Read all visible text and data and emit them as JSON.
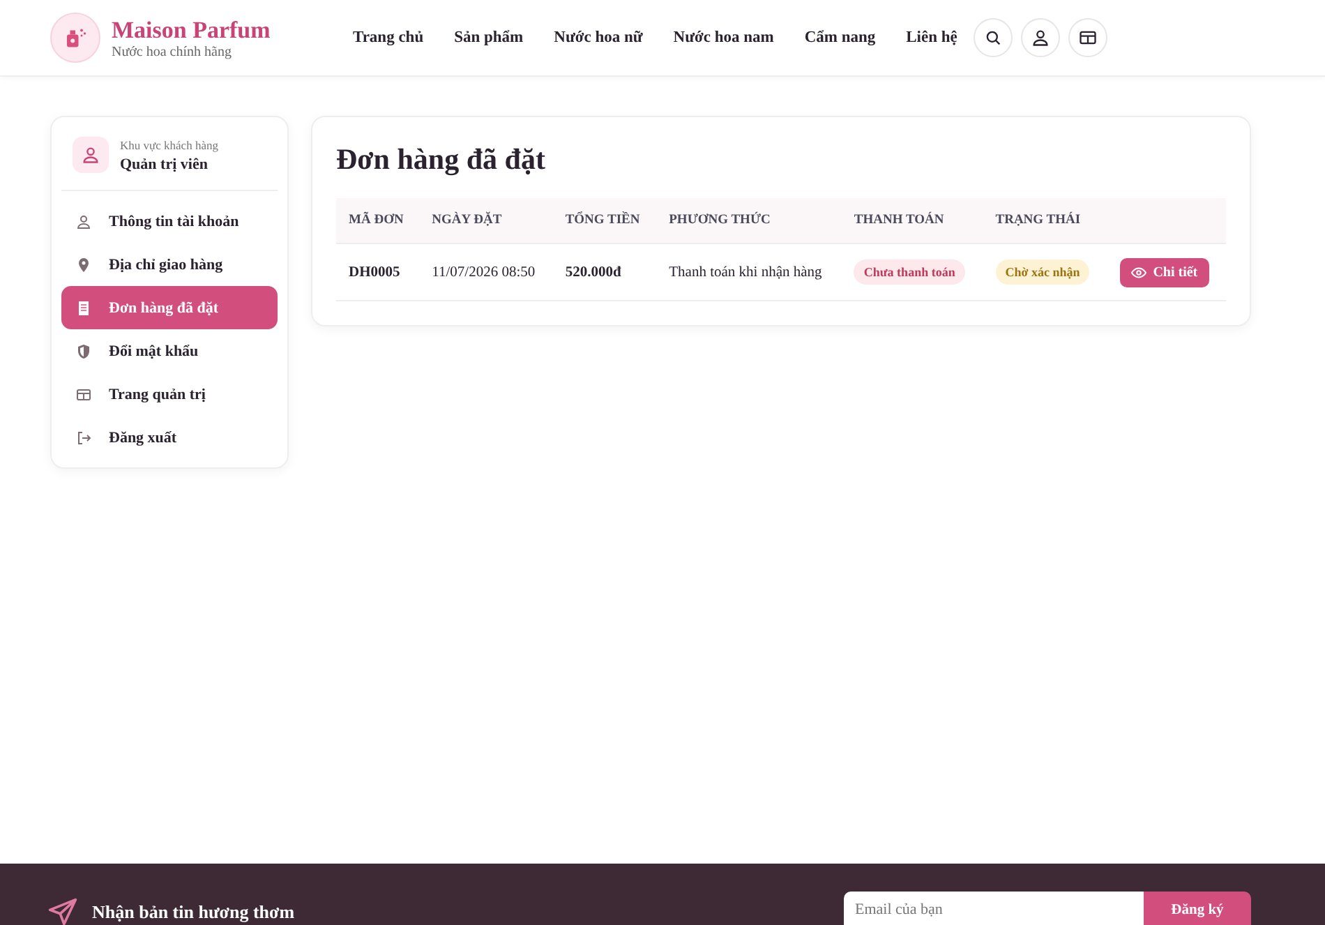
{
  "brand": {
    "name": "Maison Parfum",
    "tagline": "Nước hoa chính hãng"
  },
  "nav": [
    {
      "label": "Trang chủ"
    },
    {
      "label": "Sản phẩm"
    },
    {
      "label": "Nước hoa nữ"
    },
    {
      "label": "Nước hoa nam"
    },
    {
      "label": "Cẩm nang"
    },
    {
      "label": "Liên hệ"
    }
  ],
  "header_actions": [
    {
      "kind": "search"
    },
    {
      "kind": "user"
    },
    {
      "kind": "layout"
    }
  ],
  "sidebar": {
    "area_label": "Khu vực khách hàng",
    "user_name": "Quản trị viên",
    "items": [
      {
        "label": "Thông tin tài khoản",
        "kind": "user",
        "selected": false
      },
      {
        "label": "Địa chỉ giao hàng",
        "kind": "pin",
        "selected": false
      },
      {
        "label": "Đơn hàng đã đặt",
        "kind": "doc",
        "selected": true
      },
      {
        "label": "Đổi mật khẩu",
        "kind": "shield",
        "selected": false
      },
      {
        "label": "Trang quản trị",
        "kind": "layout",
        "selected": false
      },
      {
        "label": "Đăng xuất",
        "kind": "logout",
        "selected": false
      }
    ]
  },
  "orders": {
    "title": "Đơn hàng đã đặt",
    "columns": [
      "MÃ ĐƠN",
      "NGÀY ĐẶT",
      "TỔNG TIỀN",
      "PHƯƠNG THỨC",
      "THANH TOÁN",
      "TRẠNG THÁI"
    ],
    "rows": [
      {
        "code": "DH0005",
        "date": "11/07/2026 08:50",
        "total": "520.000đ",
        "method": "Thanh toán khi nhận hàng",
        "payment": {
          "label": "Chưa thanh toán",
          "kind": "unpaid"
        },
        "status": {
          "label": "Chờ xác nhận",
          "kind": "pending"
        },
        "action": "Chi tiết"
      }
    ]
  },
  "footer": {
    "newsletter_title": "Nhận bản tin hương thơm",
    "email_placeholder": "Email của bạn",
    "subscribe": "Đăng ký"
  }
}
